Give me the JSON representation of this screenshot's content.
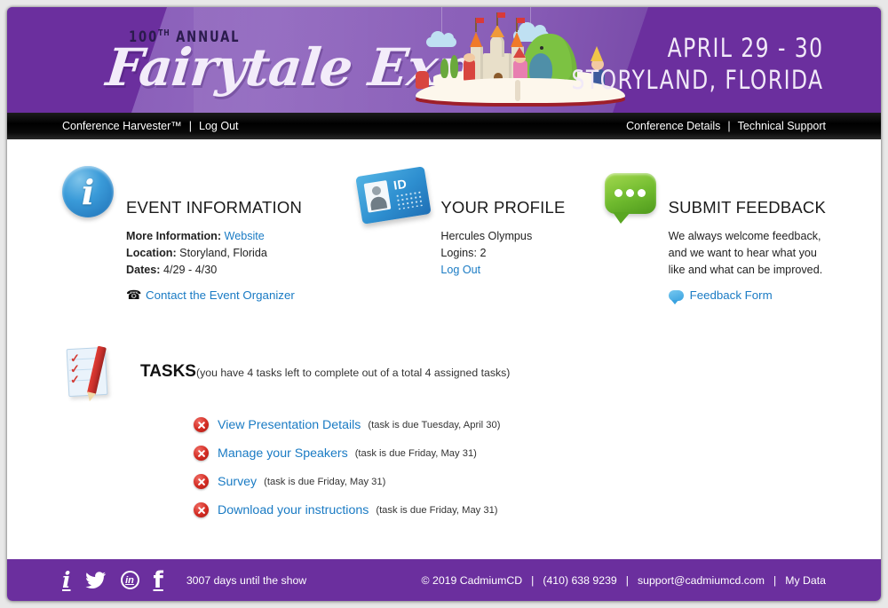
{
  "banner": {
    "annual_prefix": "100",
    "annual_sup": "TH",
    "annual_suffix": "ANNUAL",
    "logo": "Fairytale Expo",
    "dates": "APRIL 29 - 30",
    "location": "STORYLAND, FLORIDA",
    "bg_color": "#6b2f9e"
  },
  "navbar": {
    "left": [
      {
        "label": "Conference Harvester™"
      },
      {
        "label": "Log Out"
      }
    ],
    "right": [
      {
        "label": "Conference Details"
      },
      {
        "label": "Technical Support"
      }
    ],
    "separator": "|"
  },
  "cards": [
    {
      "icon": "info-circle-icon",
      "title": "EVENT INFORMATION",
      "more_info_label": "More Information:",
      "more_info_link": "Website",
      "location_label": "Location:",
      "location_value": "Storyland, Florida",
      "dates_label": "Dates:",
      "dates_value": "4/29 - 4/30",
      "contact_link": "Contact the Event Organizer"
    },
    {
      "icon": "id-badge-icon",
      "title": "YOUR PROFILE",
      "user_name": "Hercules Olympus",
      "logins_label": "Logins:",
      "logins_value": "2",
      "logout_link": "Log Out"
    },
    {
      "icon": "speech-bubble-icon",
      "title": "SUBMIT FEEDBACK",
      "text_line1": "We always welcome feedback,",
      "text_line2": "and we want to hear what you",
      "text_line3": "like and what can be improved.",
      "feedback_link": "Feedback Form"
    }
  ],
  "tasks": {
    "heading": "TASKS",
    "summary": "(you have 4 tasks left to complete out of a total 4 assigned tasks)",
    "items": [
      {
        "label": "View Presentation Details",
        "due": "(task is due Tuesday, April 30)"
      },
      {
        "label": "Manage your Speakers",
        "due": "(task is due Friday, May 31)"
      },
      {
        "label": "Survey",
        "due": "(task is due Friday, May 31)"
      },
      {
        "label": "Download your instructions",
        "due": "(task is due Friday, May 31)"
      }
    ]
  },
  "footer": {
    "social": [
      {
        "name": "info-icon",
        "glyph": "i"
      },
      {
        "name": "twitter-icon",
        "glyph": ""
      },
      {
        "name": "linkedin-icon",
        "glyph": "in"
      },
      {
        "name": "facebook-icon",
        "glyph": "f"
      }
    ],
    "countdown": "3007 days until the show",
    "copyright": "© 2019 CadmiumCD",
    "phone": "(410) 638 9239",
    "email": "support@cadmiumcd.com",
    "my_data": "My Data",
    "separator": "|",
    "bg_color": "#6b2f9e"
  }
}
